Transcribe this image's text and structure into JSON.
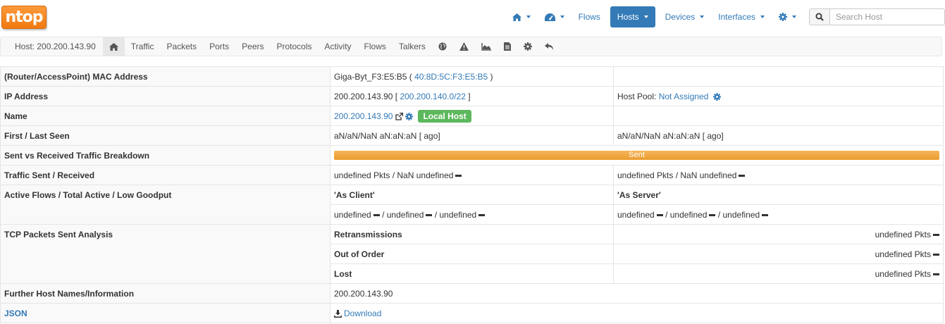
{
  "logo": {
    "text": "ntop"
  },
  "topnav": {
    "flows": "Flows",
    "hosts": "Hosts",
    "devices": "Devices",
    "interfaces": "Interfaces",
    "search_placeholder": "Search Host"
  },
  "subnav": {
    "host": "Host: 200.200.143.90",
    "tabs": [
      "Traffic",
      "Packets",
      "Ports",
      "Peers",
      "Protocols",
      "Activity",
      "Flows",
      "Talkers"
    ]
  },
  "rows": {
    "mac": {
      "label": "(Router/AccessPoint) MAC Address",
      "name": "Giga-Byt_F3:E5:B5",
      "open": "(",
      "addr": "40:8D:5C:F3:E5:B5",
      "close": ")"
    },
    "ip": {
      "label": "IP Address",
      "value": "200.200.143.90",
      "open": "[",
      "net": "200.200.140.0/22",
      "close": "]",
      "pool_label": "Host Pool:",
      "pool_value": "Not Assigned"
    },
    "name": {
      "label": "Name",
      "value": "200.200.143.90",
      "badge": "Local Host"
    },
    "seen": {
      "label": "First / Last Seen",
      "first": "aN/aN/NaN aN:aN:aN [ ago]",
      "last": "aN/aN/NaN aN:aN:aN [ ago]"
    },
    "breakdown": {
      "label": "Sent vs Received Traffic Breakdown",
      "bar": "Sent"
    },
    "traffic": {
      "label": "Traffic Sent / Received",
      "sent": "undefined Pkts / NaN undefined",
      "received": "undefined Pkts / NaN undefined"
    },
    "flows": {
      "label": "Active Flows / Total Active / Low Goodput",
      "client": "'As Client'",
      "server": "'As Server'",
      "undefined": "undefined",
      "sep": "/"
    },
    "tcp": {
      "label": "TCP Packets Sent Analysis",
      "retrans": "Retransmissions",
      "ooo": "Out of Order",
      "lost": "Lost",
      "value": "undefined Pkts"
    },
    "further": {
      "label": "Further Host Names/Information",
      "value": "200.200.143.90"
    },
    "json": {
      "label": "JSON",
      "download": "Download"
    }
  },
  "colors": {
    "accent": "#337ab7",
    "brand": "#f07a10",
    "success": "#5cb85c",
    "bar": "#f0ad4e"
  }
}
